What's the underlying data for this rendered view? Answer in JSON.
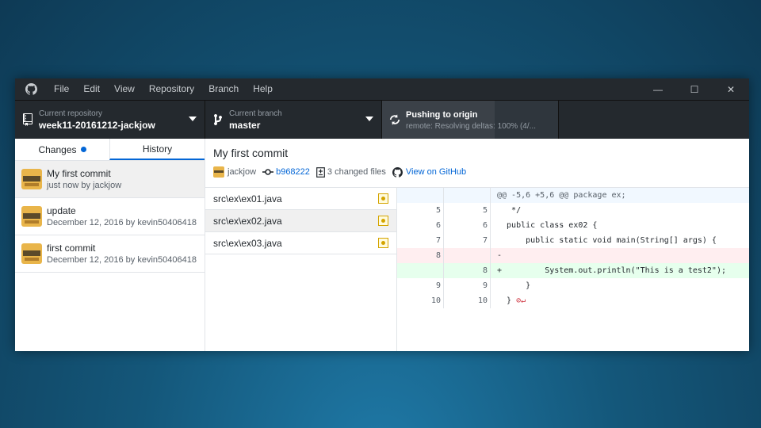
{
  "menu": [
    "File",
    "Edit",
    "View",
    "Repository",
    "Branch",
    "Help"
  ],
  "window_controls": {
    "minimize": "—",
    "maximize": "☐",
    "close": "✕"
  },
  "toolbar": {
    "repo_label": "Current repository",
    "repo_value": "week11-20161212-jackjow",
    "branch_label": "Current branch",
    "branch_value": "master",
    "push_title": "Pushing to origin",
    "push_status": "remote: Resolving deltas: 100% (4/..."
  },
  "tabs": {
    "changes": "Changes",
    "history": "History"
  },
  "commits": [
    {
      "title": "My first commit",
      "meta": "just now by jackjow"
    },
    {
      "title": "update",
      "meta": "December 12, 2016 by kevin50406418"
    },
    {
      "title": "first commit",
      "meta": "December 12, 2016 by kevin50406418"
    }
  ],
  "commit_detail": {
    "title": "My first commit",
    "author": "jackjow",
    "sha": "b968222",
    "changed_files": "3 changed files",
    "github_link": "View on GitHub"
  },
  "files": [
    "src\\ex\\ex01.java",
    "src\\ex\\ex02.java",
    "src\\ex\\ex03.java"
  ],
  "diff": {
    "hunk": "@@ -5,6 +5,6 @@ package ex;",
    "rows": [
      {
        "old": "5",
        "new": "5",
        "code": "   */"
      },
      {
        "old": "6",
        "new": "6",
        "code": "  public class ex02 {"
      },
      {
        "old": "7",
        "new": "7",
        "code": "      public static void main(String[] args) {"
      },
      {
        "old": "8",
        "new": "",
        "code": "-"
      },
      {
        "old": "",
        "new": "8",
        "code": "+         System.out.println(\"This is a test2\");"
      },
      {
        "old": "9",
        "new": "9",
        "code": "      }"
      },
      {
        "old": "10",
        "new": "10",
        "code": "  }"
      }
    ]
  }
}
